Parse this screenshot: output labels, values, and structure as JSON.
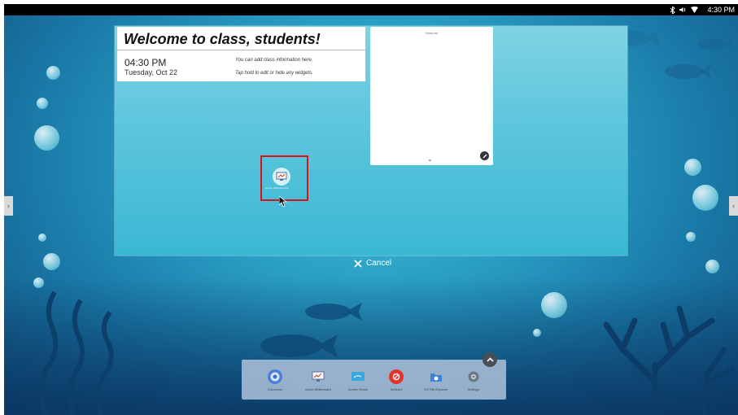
{
  "status_bar": {
    "time": "4:30 PM",
    "icons": [
      "bluetooth-icon",
      "volume-icon",
      "wifi-icon"
    ]
  },
  "welcome_widget": {
    "title": "Welcome to class, students!",
    "time": "04:30 PM",
    "date": "Tuesday, Oct 22",
    "info_line1": "You can add class information here.",
    "info_line2": "Tap hold to edit or hide any widgets."
  },
  "notepad_widget": {
    "title": "Notepad"
  },
  "dragging_app": {
    "label": "Annie Whiteboard"
  },
  "cancel_label": "Cancel",
  "dock": {
    "items": [
      {
        "label": "Chromium",
        "icon": "chromium-icon",
        "color": "#4a80d8"
      },
      {
        "label": "Annie Whiteboard",
        "icon": "whiteboard-icon",
        "color": "#b7c6e8"
      },
      {
        "label": "Screen Share",
        "icon": "screen-share-icon",
        "color": "#3aa7dc"
      },
      {
        "label": "Sphere2",
        "icon": "sphere-icon",
        "color": "#e2332e"
      },
      {
        "label": "ES File Explorer",
        "icon": "file-explorer-icon",
        "color": "#3d82d6"
      },
      {
        "label": "Settings",
        "icon": "settings-icon",
        "color": "#6c7a86"
      }
    ]
  },
  "colors": {
    "highlight": "#e0101a",
    "status_bar": "#000000"
  }
}
